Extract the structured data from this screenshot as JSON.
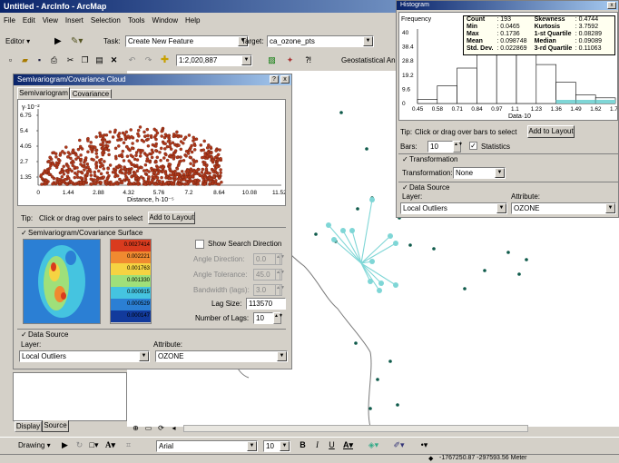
{
  "app": {
    "title": "Untitled - ArcInfo - ArcMap"
  },
  "menu": [
    "File",
    "Edit",
    "View",
    "Insert",
    "Selection",
    "Tools",
    "Window",
    "Help"
  ],
  "editor": {
    "editor_label": "Editor ▾",
    "task_label": "Task:",
    "task_value": "Create New Feature",
    "target_label": "Target:",
    "target_value": "ca_ozone_pts"
  },
  "standard_toolbar": {
    "scale_value": "1:2,020,887",
    "geostat_label": "Geostatistical Ana"
  },
  "semivariogram": {
    "title": "Semivariogram/Covariance Cloud",
    "tabs": [
      "Semivariogram",
      "Covariance"
    ],
    "y_axis_title": "γ·10⁻²",
    "y_ticks": [
      "6.75",
      "5.4",
      "4.05",
      "2.7",
      "1.35"
    ],
    "x_ticks": [
      "0",
      "1.44",
      "2.88",
      "4.32",
      "5.76",
      "7.2",
      "8.64",
      "10.08",
      "11.52"
    ],
    "x_axis_title": "Distance, h·10⁻⁵",
    "tip_label": "Tip:",
    "tip_text": "Click or drag over pairs to select",
    "add_layout": "Add to Layout",
    "surface_title": "Semivariogram/Covariance Surface",
    "legend_values": [
      "0.0027414",
      "0.002221",
      "0.001763",
      "0.001330",
      "0.000915",
      "0.000529",
      "0.000147"
    ],
    "show_search_direction": "Show Search Direction",
    "angle_direction_label": "Angle Direction:",
    "angle_direction_value": "0.0",
    "angle_tolerance_label": "Angle Tolerance:",
    "angle_tolerance_value": "45.0",
    "bandwidth_label": "Bandwidth (lags):",
    "bandwidth_value": "3.0",
    "lag_size_label": "Lag Size:",
    "lag_size_value": "113570",
    "num_lags_label": "Number of Lags:",
    "num_lags_value": "10",
    "datasource_title": "Data Source",
    "layer_label": "Layer:",
    "layer_value": "Local Outliers",
    "attribute_label": "Attribute:",
    "attribute_value": "OZONE",
    "cloud_color": "#b23a1c"
  },
  "histogram": {
    "title": "Histogram",
    "y_axis_title": "Frequency",
    "y_ticks": [
      "40",
      "38.4",
      "28.8",
      "19.2",
      "9.6",
      "0"
    ],
    "x_ticks": [
      "0.45",
      "0.58",
      "0.71",
      "0.84",
      "0.97",
      "1.1",
      "1.23",
      "1.36",
      "1.49",
      "1.62",
      "1.75"
    ],
    "x_axis_title": "Data·10",
    "stats": [
      [
        "Count",
        ": 193",
        "Skewness",
        ": 0.4744"
      ],
      [
        "Min",
        ": 0.0465",
        "Kurtosis",
        ": 3.7592"
      ],
      [
        "Max",
        ": 0.1736",
        "1-st Quartile",
        ": 0.08289"
      ],
      [
        "Mean",
        ": 0.098748",
        "Median",
        ": 0.09089"
      ],
      [
        "Std. Dev.",
        ": 0.022869",
        "3-rd Quartile",
        ": 0.11063"
      ]
    ],
    "tip_label": "Tip:",
    "tip_text": "Click or drag over bars to select",
    "add_layout": "Add to Layout",
    "bars_label": "Bars:",
    "bars_value": "10",
    "statistics_label": "Statistics",
    "transformation_title": "Transformation",
    "transformation_label": "Transformation:",
    "transformation_value": "None",
    "datasource_title": "Data Source",
    "layer_label": "Layer:",
    "layer_value": "Local Outliers",
    "attribute_label": "Attribute:",
    "attribute_value": "OZONE",
    "bar_heights_frac": [
      0.06,
      0.25,
      0.5,
      0.78,
      0.95,
      0.82,
      0.55,
      0.3,
      0.12,
      0.08
    ],
    "bar_color": "#ffffff",
    "selected_color": "#7fd6d6"
  },
  "toc_tabs": [
    "Display",
    "Source"
  ],
  "drawing": {
    "drawing_label": "Drawing ▾",
    "font_value": "Arial",
    "font_size_value": "10"
  },
  "status": {
    "coords": "-1767250.87  -297593.56 Meter"
  },
  "map": {
    "point_color": "#0e5a4a",
    "link_color": "#7fd6d6",
    "coast_color": "#7a7a7a"
  }
}
